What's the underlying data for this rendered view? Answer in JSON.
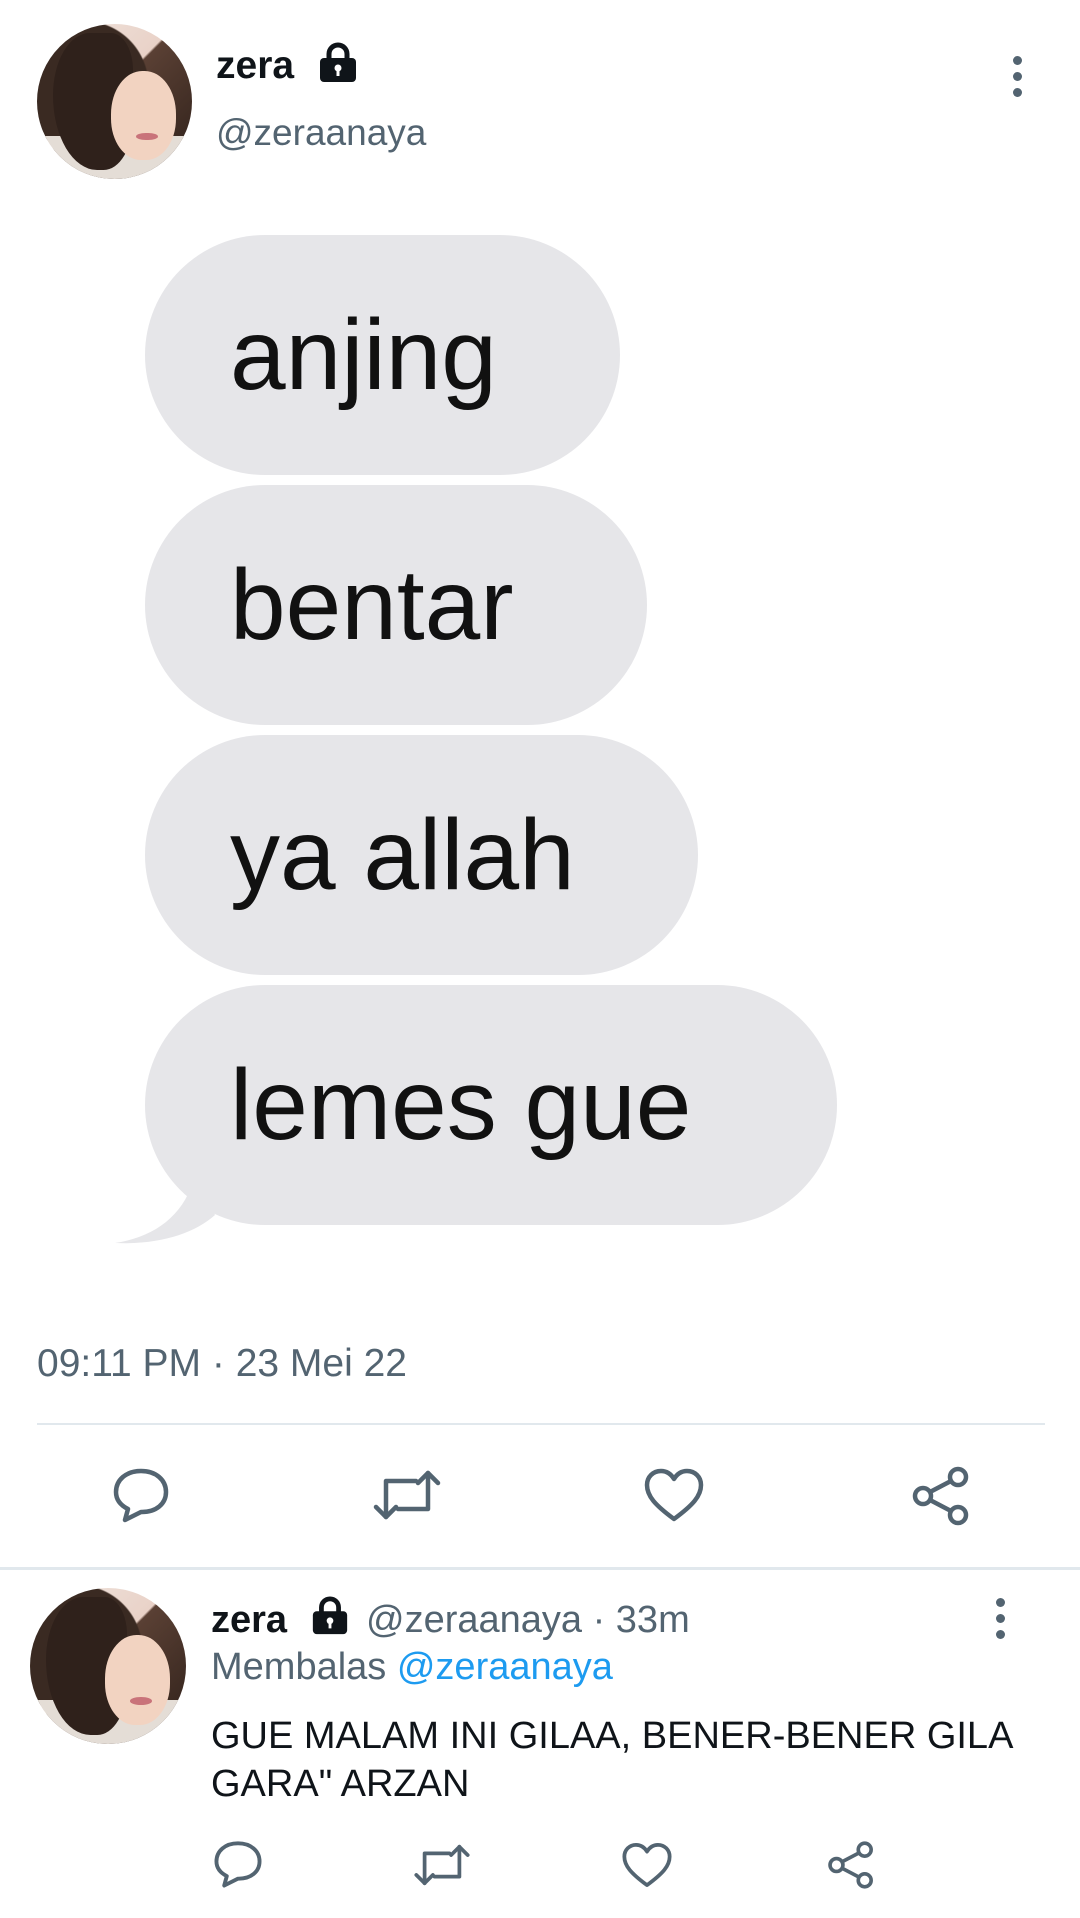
{
  "main_tweet": {
    "author_name": "zera",
    "handle": "@zeraanaya",
    "media_bubbles": [
      "anjing",
      "bentar",
      "ya allah",
      "lemes gue"
    ],
    "timestamp": "09:11 PM · 23 Mei 22",
    "icons": {
      "lock": "lock-icon",
      "more": "more-vertical-icon",
      "reply": "reply-icon",
      "retweet": "retweet-icon",
      "like": "heart-icon",
      "share": "share-icon"
    }
  },
  "reply_tweet": {
    "author_name": "zera",
    "meta": "@zeraanaya · 33m",
    "replying_prefix": "Membalas",
    "replying_mention": "@zeraanaya",
    "text": "GUE MALAM INI GILAA, BENER-BENER GILA GARA\" ARZAN"
  },
  "colors": {
    "primary_text": "#0f1419",
    "secondary_text": "#536471",
    "mention": "#1d9bf0",
    "bubble": "#e6e6e9",
    "divider": "#e1e8ed"
  }
}
